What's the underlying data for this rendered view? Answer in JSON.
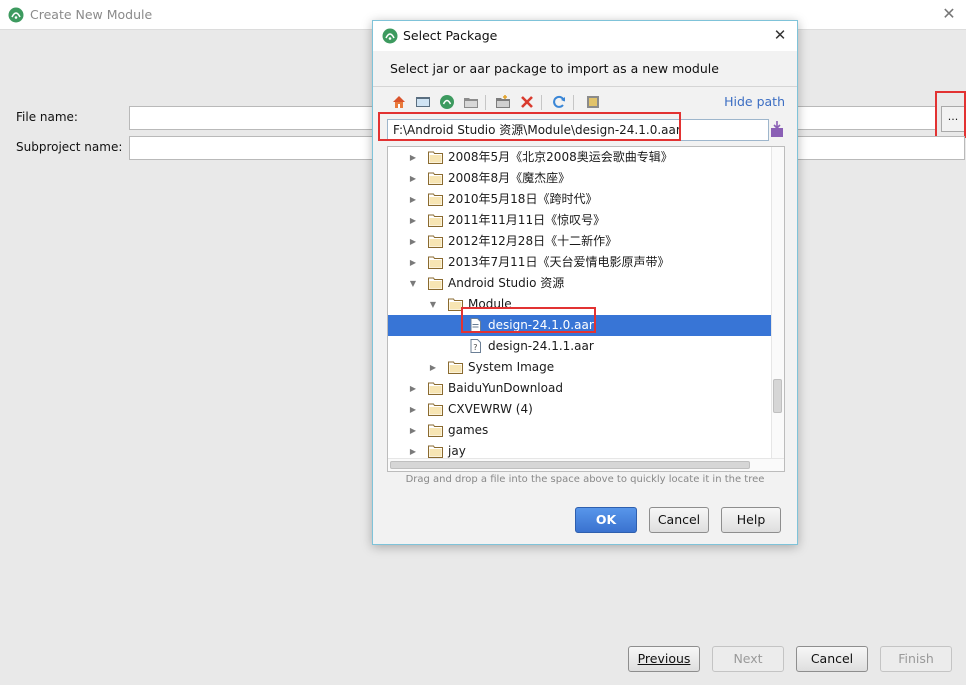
{
  "window": {
    "title": "Create New Module",
    "file_name_label": "File name:",
    "subproject_label": "Subproject name:",
    "file_name_value": "",
    "subproject_value": "",
    "browse_label": "...",
    "buttons": {
      "previous": "Previous",
      "next": "Next",
      "cancel": "Cancel",
      "finish": "Finish"
    }
  },
  "dialog": {
    "title": "Select Package",
    "description": "Select jar or aar package to import as a new module",
    "hide_path": "Hide path",
    "path_value": "F:\\Android Studio 资源\\Module\\design-24.1.0.aar",
    "toolbar_icons": [
      "home-icon",
      "desktop-icon",
      "android-project-icon",
      "module-folder-icon",
      "new-folder-icon",
      "delete-icon",
      "refresh-icon",
      "show-hidden-icon"
    ],
    "tree": [
      {
        "label": "2008年5月《北京2008奥运会歌曲专辑》",
        "depth": 0,
        "type": "folder",
        "state": "collapsed"
      },
      {
        "label": "2008年8月《魔杰座》",
        "depth": 0,
        "type": "folder",
        "state": "collapsed"
      },
      {
        "label": "2010年5月18日《跨时代》",
        "depth": 0,
        "type": "folder",
        "state": "collapsed"
      },
      {
        "label": "2011年11月11日《惊叹号》",
        "depth": 0,
        "type": "folder",
        "state": "collapsed"
      },
      {
        "label": "2012年12月28日《十二新作》",
        "depth": 0,
        "type": "folder",
        "state": "collapsed"
      },
      {
        "label": "2013年7月11日《天台爱情电影原声带》",
        "depth": 0,
        "type": "folder",
        "state": "collapsed"
      },
      {
        "label": "Android Studio 资源",
        "depth": 0,
        "type": "folder",
        "state": "expanded"
      },
      {
        "label": "Module",
        "depth": 1,
        "type": "folder",
        "state": "expanded"
      },
      {
        "label": "design-24.1.0.aar",
        "depth": 2,
        "type": "file",
        "state": "leaf",
        "selected": true
      },
      {
        "label": "design-24.1.1.aar",
        "depth": 2,
        "type": "unknown-file",
        "state": "leaf"
      },
      {
        "label": "System Image",
        "depth": 1,
        "type": "folder",
        "state": "collapsed"
      },
      {
        "label": "BaiduYunDownload",
        "depth": 0,
        "type": "folder",
        "state": "collapsed"
      },
      {
        "label": "CXVEWRW (4)",
        "depth": 0,
        "type": "folder",
        "state": "collapsed"
      },
      {
        "label": "games",
        "depth": 0,
        "type": "folder",
        "state": "collapsed"
      },
      {
        "label": "jay",
        "depth": 0,
        "type": "folder",
        "state": "collapsed"
      }
    ],
    "hint": "Drag and drop a file into the space above to quickly locate it in the tree",
    "buttons": {
      "ok": "OK",
      "cancel": "Cancel",
      "help": "Help"
    }
  },
  "colors": {
    "selection": "#3875d6",
    "link": "#3c6ec3",
    "highlight": "#e23232",
    "primary_button": "#3a72cf"
  }
}
